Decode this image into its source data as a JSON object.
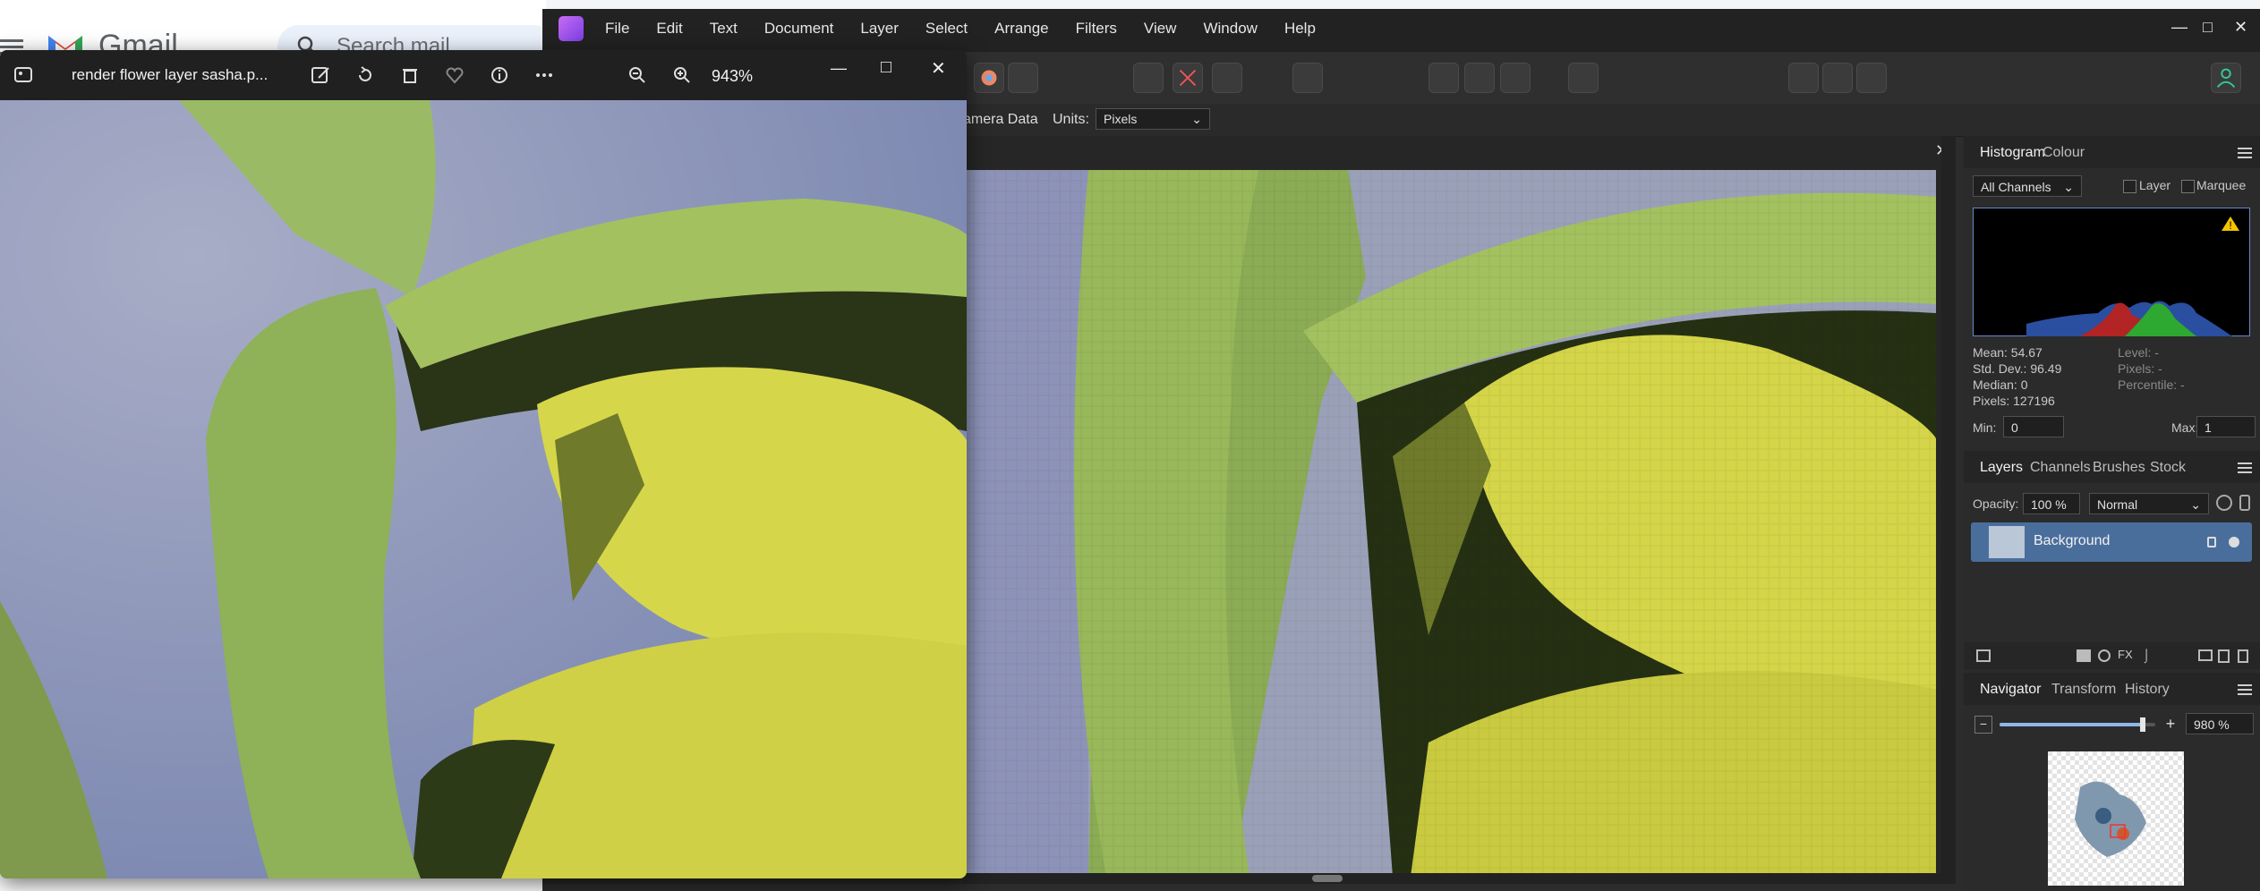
{
  "gmail": {
    "brand": "Gmail",
    "search_placeholder": "Search mail"
  },
  "affinity": {
    "menu": [
      "File",
      "Edit",
      "Text",
      "Document",
      "Layer",
      "Select",
      "Arrange",
      "Filters",
      "View",
      "Window",
      "Help"
    ],
    "context_bar": {
      "camera_data": "amera Data",
      "units_label": "Units:",
      "units_value": "Pixels"
    },
    "histogram": {
      "tabs": [
        "Histogram",
        "Colour"
      ],
      "channel_select": "All Channels",
      "layer_check_label": "Layer",
      "marquee_check_label": "Marquee",
      "stats_left": [
        "Mean: 54.67",
        "Std. Dev.: 96.49",
        "Median: 0",
        "Pixels: 127196"
      ],
      "stats_right": [
        "Level: -",
        "Pixels: -",
        "Percentile: -"
      ],
      "min_label": "Min:",
      "min_value": "0",
      "max_label": "Max:",
      "max_value": "1"
    },
    "layers": {
      "tabs": [
        "Layers",
        "Channels",
        "Brushes",
        "Stock"
      ],
      "opacity_label": "Opacity:",
      "opacity_value": "100 %",
      "blend_mode": "Normal",
      "items": [
        {
          "name": "Background"
        }
      ]
    },
    "navigator": {
      "tabs": [
        "Navigator",
        "Transform",
        "History"
      ],
      "zoom_value": "980 %",
      "zoom_level": 0.92
    }
  },
  "photos": {
    "title": "render flower layer sasha.p...",
    "zoom": "943%"
  },
  "colors": {
    "affinity_bg": "#2c2c2c",
    "selection_blue": "#4a6e9c",
    "leaf_green": "#9fbf57",
    "petal_yellow": "#dcdc45"
  }
}
